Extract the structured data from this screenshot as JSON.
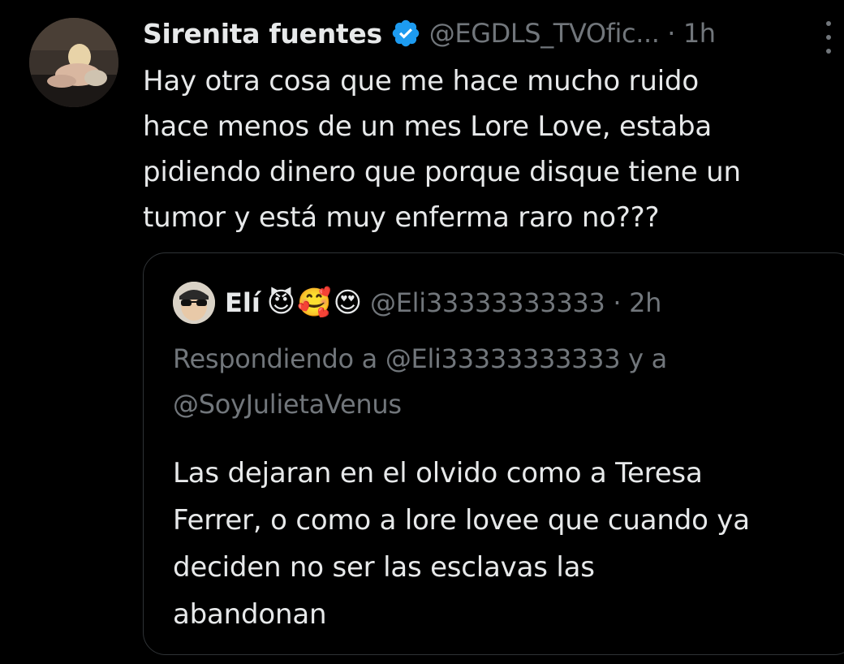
{
  "tweet": {
    "author_name": "Sirenita fuentes",
    "meta": "@EGDLS_TVOfic... · 1h",
    "verified_icon": "verified-badge-icon",
    "more_icon": "more-vertical-icon",
    "text": "Hay otra cosa que me hace mucho ruido\nhace menos de un mes Lore Love, estaba\npidiendo dinero que porque disque tiene un\ntumor y está muy enferma raro no???"
  },
  "quoted_tweet": {
    "author_name": "Elí",
    "emojis": [
      "😈",
      "🥰",
      "😍"
    ],
    "meta": "@Eli33333333333 · 2h",
    "replying_to": "Respondiendo a @Eli33333333333 y a\n@SoyJulietaVenus",
    "text": "Las dejaran en el olvido como a Teresa\nFerrer, o como a lore lovee que cuando ya\ndeciden no ser las esclavas las\nabandonan"
  },
  "colors": {
    "background": "#000000",
    "text_primary": "#e7e9ea",
    "text_secondary": "#71767b",
    "border": "#2f3336",
    "verified_blue": "#1d9bf0"
  }
}
